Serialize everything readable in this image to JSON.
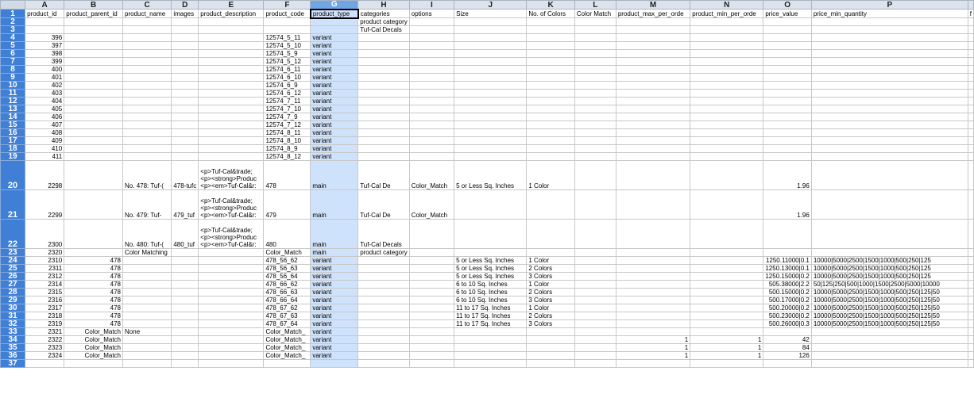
{
  "columns": [
    "A",
    "B",
    "C",
    "D",
    "E",
    "F",
    "G",
    "H",
    "I",
    "J",
    "K",
    "L",
    "M",
    "N",
    "O",
    "P"
  ],
  "selected_column": "G",
  "extra_header_fragment": "f",
  "header_row": [
    "product_id",
    "product_parent_id",
    "product_name",
    "images",
    "product_description",
    "product_code",
    "product_type",
    "categories",
    "options",
    "Size",
    "No. of Colors",
    "Color Match",
    "product_max_per_orde",
    "product_min_per_orde",
    "price_value",
    "price_min_quantity"
  ],
  "rows": [
    {
      "n": "2",
      "cells": {
        "H": "product category"
      }
    },
    {
      "n": "3",
      "cells": {
        "H": "Tuf-Cal Decals"
      }
    },
    {
      "n": "4",
      "cells": {
        "A": "396",
        "F": "12574_5_11",
        "G": "variant"
      }
    },
    {
      "n": "5",
      "cells": {
        "A": "397",
        "F": "12574_5_10",
        "G": "variant"
      }
    },
    {
      "n": "6",
      "cells": {
        "A": "398",
        "F": "12574_5_9",
        "G": "variant"
      }
    },
    {
      "n": "7",
      "cells": {
        "A": "399",
        "F": "12574_5_12",
        "G": "variant"
      }
    },
    {
      "n": "8",
      "cells": {
        "A": "400",
        "F": "12574_6_11",
        "G": "variant"
      }
    },
    {
      "n": "9",
      "cells": {
        "A": "401",
        "F": "12574_6_10",
        "G": "variant"
      }
    },
    {
      "n": "10",
      "cells": {
        "A": "402",
        "F": "12574_6_9",
        "G": "variant"
      }
    },
    {
      "n": "11",
      "cells": {
        "A": "403",
        "F": "12574_6_12",
        "G": "variant"
      }
    },
    {
      "n": "12",
      "cells": {
        "A": "404",
        "F": "12574_7_11",
        "G": "variant"
      }
    },
    {
      "n": "13",
      "cells": {
        "A": "405",
        "F": "12574_7_10",
        "G": "variant"
      }
    },
    {
      "n": "14",
      "cells": {
        "A": "406",
        "F": "12574_7_9",
        "G": "variant"
      }
    },
    {
      "n": "15",
      "cells": {
        "A": "407",
        "F": "12574_7_12",
        "G": "variant"
      }
    },
    {
      "n": "16",
      "cells": {
        "A": "408",
        "F": "12574_8_11",
        "G": "variant"
      }
    },
    {
      "n": "17",
      "cells": {
        "A": "409",
        "F": "12574_8_10",
        "G": "variant"
      }
    },
    {
      "n": "18",
      "cells": {
        "A": "410",
        "F": "12574_8_9",
        "G": "variant"
      }
    },
    {
      "n": "19",
      "cells": {
        "A": "411",
        "F": "12574_8_12",
        "G": "variant"
      }
    },
    {
      "n": "20",
      "tall": true,
      "cells": {
        "A": "2298",
        "C": "No. 478: Tuf-(",
        "D": "478-tufc",
        "E": "<p>Tuf-Cal&trade;\n<p><strong>Produc\n<p><em>Tuf-Cal&r:",
        "F": "478",
        "G": "main",
        "H": "Tuf-Cal De",
        "I": "Color_Match",
        "J": "5 or Less Sq. Inches",
        "K": "1 Color",
        "O": "1.96"
      }
    },
    {
      "n": "21",
      "tall": true,
      "cells": {
        "A": "2299",
        "C": "No. 479: Tuf-",
        "D": "479_tuf",
        "E": "<p>Tuf-Cal&trade;\n<p><strong>Produc\n<p><em>Tuf-Cal&r:",
        "F": "479",
        "G": "main",
        "H": "Tuf-Cal De",
        "I": "Color_Match",
        "O": "1.96"
      }
    },
    {
      "n": "22",
      "tall": true,
      "cells": {
        "A": "2300",
        "C": "No. 480: Tuf-(",
        "D": "480_tuf",
        "E": "<p>Tuf-Cal&trade;\n<p><strong>Produc\n<p><em>Tuf-Cal&r:",
        "F": "480",
        "G": "main",
        "H": "Tuf-Cal Decals"
      }
    },
    {
      "n": "23",
      "cells": {
        "A": "2320",
        "C": "Color Matching",
        "F": "Color_Match",
        "G": "main",
        "H": "product category"
      }
    },
    {
      "n": "24",
      "cells": {
        "A": "2310",
        "B": "478",
        "F": "478_56_62",
        "G": "variant",
        "J": "5 or Less Sq. Inches",
        "K": "1 Color",
        "O": "1250.11000|0.1",
        "P": "10000|5000|2500|1500|1000|500|250|125"
      }
    },
    {
      "n": "25",
      "cells": {
        "A": "2311",
        "B": "478",
        "F": "478_56_63",
        "G": "variant",
        "J": "5 or Less Sq. Inches",
        "K": "2 Colors",
        "O": "1250.13000|0.1",
        "P": "10000|5000|2500|1500|1000|500|250|125"
      }
    },
    {
      "n": "26",
      "cells": {
        "A": "2312",
        "B": "478",
        "F": "478_56_64",
        "G": "variant",
        "J": "5 or Less Sq. Inches",
        "K": "3 Colors",
        "O": "1250.15000|0.2",
        "P": "10000|5000|2500|1500|1000|500|250|125"
      }
    },
    {
      "n": "27",
      "cells": {
        "A": "2314",
        "B": "478",
        "F": "478_66_62",
        "G": "variant",
        "J": "6 to 10 Sq. Inches",
        "K": "1 Color",
        "O": "505.38000|2.2",
        "P": "50|125|250|500|1000|1500|2500|5000|10000"
      }
    },
    {
      "n": "28",
      "cells": {
        "A": "2315",
        "B": "478",
        "F": "478_66_63",
        "G": "variant",
        "J": "6 to 10 Sq. Inches",
        "K": "2 Colors",
        "O": "500.15000|0.2",
        "P": "10000|5000|2500|1500|1000|500|250|125|50"
      }
    },
    {
      "n": "29",
      "cells": {
        "A": "2316",
        "B": "478",
        "F": "478_66_64",
        "G": "variant",
        "J": "6 to 10 Sq. Inches",
        "K": "3 Colors",
        "O": "500.17000|0.2",
        "P": "10000|5000|2500|1500|1000|500|250|125|50"
      }
    },
    {
      "n": "30",
      "cells": {
        "A": "2317",
        "B": "478",
        "F": "478_67_62",
        "G": "variant",
        "J": "11 to 17 Sq. Inches",
        "K": "1 Color",
        "O": "500.20000|0.2",
        "P": "10000|5000|2500|1500|1000|500|250|125|50"
      }
    },
    {
      "n": "31",
      "cells": {
        "A": "2318",
        "B": "478",
        "F": "478_67_63",
        "G": "variant",
        "J": "11 to 17 Sq. Inches",
        "K": "2 Colors",
        "O": "500.23000|0.2",
        "P": "10000|5000|2500|1500|1000|500|250|125|50"
      }
    },
    {
      "n": "32",
      "cells": {
        "A": "2319",
        "B": "478",
        "F": "478_67_64",
        "G": "variant",
        "J": "11 to 17 Sq. Inches",
        "K": "3 Colors",
        "O": "500.26000|0.3",
        "P": "10000|5000|2500|1500|1000|500|250|125|50"
      }
    },
    {
      "n": "33",
      "cells": {
        "A": "2321",
        "B": "Color_Match",
        "C": "None",
        "F": "Color_Match_",
        "G": "variant"
      }
    },
    {
      "n": "34",
      "cells": {
        "A": "2322",
        "B": "Color_Match",
        "F": "Color_Match_",
        "G": "variant",
        "M": "1",
        "N": "1",
        "O": "42"
      }
    },
    {
      "n": "35",
      "cells": {
        "A": "2323",
        "B": "Color_Match",
        "F": "Color_Match_",
        "G": "variant",
        "M": "1",
        "N": "1",
        "O": "84"
      }
    },
    {
      "n": "36",
      "cells": {
        "A": "2324",
        "B": "Color_Match",
        "F": "Color_Match_",
        "G": "variant",
        "M": "1",
        "N": "1",
        "O": "126"
      }
    },
    {
      "n": "37",
      "cells": {}
    }
  ]
}
